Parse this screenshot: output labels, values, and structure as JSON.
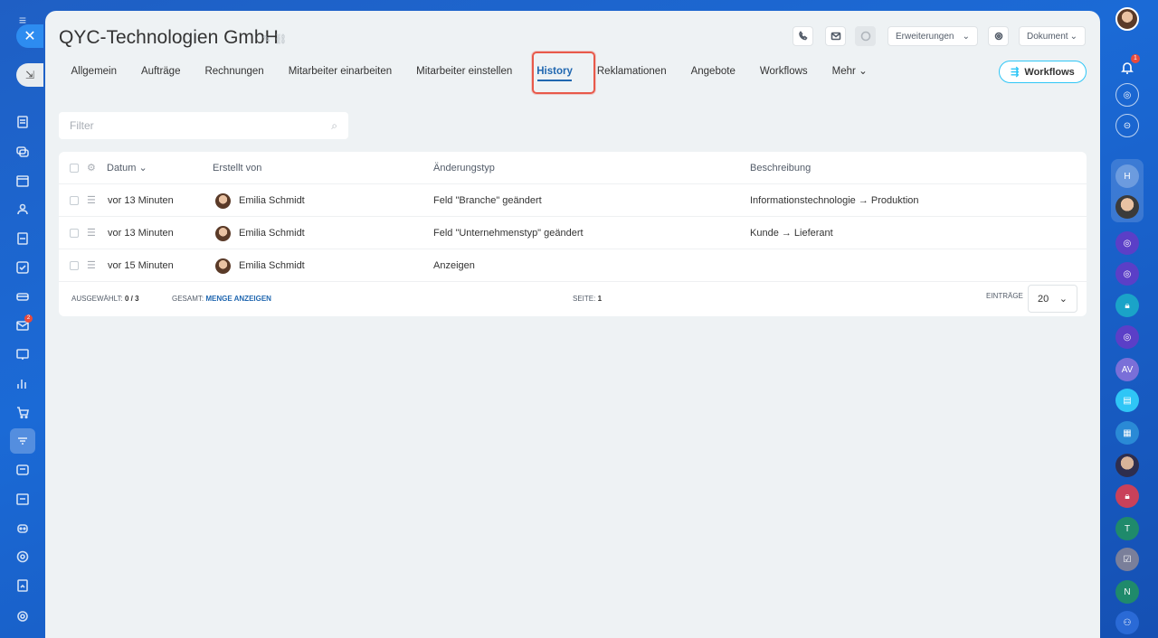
{
  "window": {
    "title": "QYC-Technologien GmbH"
  },
  "header": {
    "actions": {
      "call_icon": "phone-icon",
      "mail_icon": "mail-icon",
      "extensions_label": "Erweiterungen",
      "document_label": "Dokument"
    }
  },
  "tabs": [
    {
      "label": "Allgemein"
    },
    {
      "label": "Aufträge"
    },
    {
      "label": "Rechnungen"
    },
    {
      "label": "Mitarbeiter einarbeiten"
    },
    {
      "label": "Mitarbeiter einstellen"
    },
    {
      "label": "History",
      "active": true
    },
    {
      "label": "Reklamationen"
    },
    {
      "label": "Angebote"
    },
    {
      "label": "Workflows"
    },
    {
      "label": "Mehr"
    }
  ],
  "workflows_button": {
    "label": "Workflows"
  },
  "filter": {
    "placeholder": "Filter",
    "value": ""
  },
  "table": {
    "columns": {
      "date": "Datum",
      "created_by": "Erstellt von",
      "change_type": "Änderungstyp",
      "description": "Beschreibung"
    },
    "rows": [
      {
        "date": "vor 13 Minuten",
        "created_by": "Emilia Schmidt",
        "change_type": "Feld \"Branche\" geändert",
        "description": "Informationstechnologie → Produktion"
      },
      {
        "date": "vor 13 Minuten",
        "created_by": "Emilia Schmidt",
        "change_type": "Feld \"Unternehmenstyp\" geändert",
        "description": "Kunde → Lieferant"
      },
      {
        "date": "vor 15 Minuten",
        "created_by": "Emilia Schmidt",
        "change_type": "Anzeigen",
        "description": ""
      }
    ]
  },
  "footer": {
    "selected_label": "Ausgewählt:",
    "selected_value": "0 / 3",
    "total_label": "Gesamt:",
    "total_link": "Menge anzeigen",
    "page_label": "Seite:",
    "page_value": "1",
    "entries_label": "Einträge",
    "entries_value": "20"
  },
  "left_nav": {
    "mail_badge": "2"
  },
  "right_nav": {
    "notification_badge": "1",
    "avatar_initials": [
      "H",
      "AV",
      "T",
      "N"
    ]
  },
  "colors": {
    "accent": "#2067b0",
    "highlight": "#e8594a",
    "background": "#1b6ad6"
  }
}
